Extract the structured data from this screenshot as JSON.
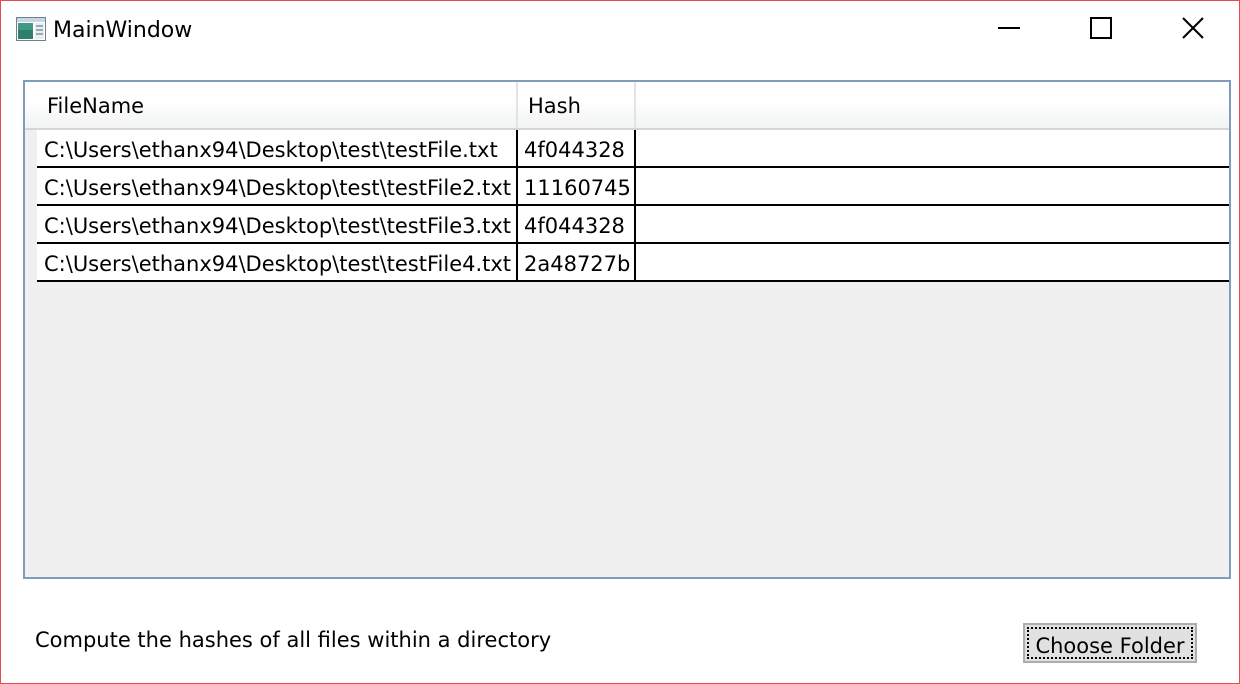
{
  "window": {
    "title": "MainWindow"
  },
  "grid": {
    "columns": [
      "FileName",
      "Hash"
    ],
    "rows": [
      {
        "filename": "C:\\Users\\ethanx94\\Desktop\\test\\testFile.txt",
        "hash": "4f044328"
      },
      {
        "filename": "C:\\Users\\ethanx94\\Desktop\\test\\testFile2.txt",
        "hash": "11160745"
      },
      {
        "filename": "C:\\Users\\ethanx94\\Desktop\\test\\testFile3.txt",
        "hash": "4f044328"
      },
      {
        "filename": "C:\\Users\\ethanx94\\Desktop\\test\\testFile4.txt",
        "hash": "2a48727b"
      }
    ]
  },
  "footer": {
    "description": "Compute the hashes of all files within a directory",
    "choose_folder_label": "Choose Folder"
  },
  "colors": {
    "window_border": "#e8474b",
    "grid_border": "#7f9db9",
    "grid_background": "#f0f0f0",
    "button_background": "#e1e1e1"
  },
  "icons": [
    "app-window-icon",
    "minimize-icon",
    "maximize-icon",
    "close-icon"
  ]
}
